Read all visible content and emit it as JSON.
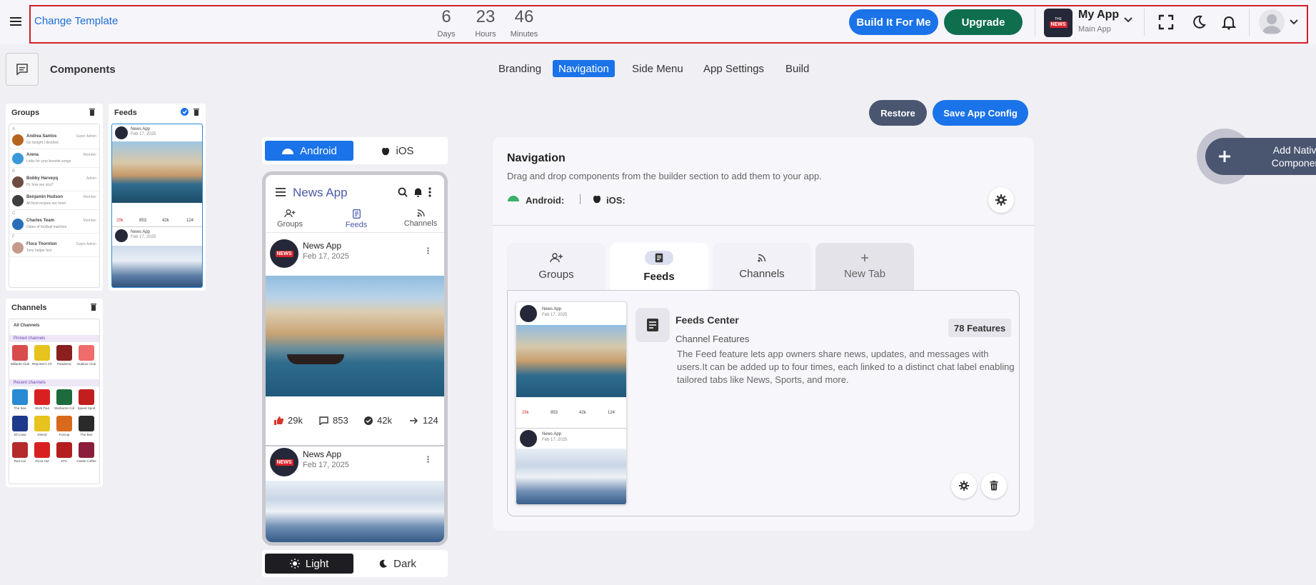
{
  "header": {
    "template_link": "Change Template",
    "countdown": [
      {
        "value": "6",
        "label": "Days"
      },
      {
        "value": "23",
        "label": "Hours"
      },
      {
        "value": "46",
        "label": "Minutes"
      }
    ],
    "build_btn": "Build It For Me",
    "upgrade_btn": "Upgrade",
    "app_name": "My App",
    "app_sub": "Main App",
    "logo_text_small": "THE",
    "logo_text": "NEWS"
  },
  "toolbar": {
    "components_title": "Components",
    "tabs": [
      "Branding",
      "Navigation",
      "Side Menu",
      "App Settings",
      "Build"
    ],
    "active_tab": "Navigation"
  },
  "left": {
    "groups_title": "Groups",
    "feeds_title": "Feeds",
    "channels_title": "Channels",
    "groups_list": [
      {
        "letter": "A",
        "name": "Andrea Santos",
        "msg": "Go tonight I decided",
        "role": "Super Admin",
        "color": "#b5651d"
      },
      {
        "letter": "",
        "name": "Arena",
        "msg": "Links for your favorite songs",
        "role": "Member",
        "color": "#3a9ad9"
      },
      {
        "letter": "B",
        "name": "Bobby Harveyq",
        "msg": "Hi, how are you?",
        "role": "Admin",
        "color": "#6d4c41"
      },
      {
        "letter": "",
        "name": "Benjamin Hudson",
        "msg": "All food recipes are here!",
        "role": "Member",
        "color": "#3e3e3e"
      },
      {
        "letter": "C",
        "name": "Charles Team",
        "msg": "Dates of football matches",
        "role": "Member",
        "color": "#2a6ebb"
      },
      {
        "letter": "F",
        "name": "Flora Thornton",
        "msg": "Tony helper text",
        "role": "Super Admin",
        "color": "#c49a8a"
      }
    ],
    "feeds_mini": {
      "name": "News App",
      "date": "Feb 17, 2025",
      "stats": [
        "29k",
        "853",
        "42k",
        "124"
      ]
    },
    "channels_header": "All Channels",
    "pinned_label": "Pinned channels",
    "recent_label": "Recent channels",
    "pinned": [
      {
        "name": "Billiards Club",
        "color": "#d94c4c"
      },
      {
        "name": "Reporter's Choice",
        "color": "#e8c21d"
      },
      {
        "name": "Pandemic",
        "color": "#8b1e1e"
      },
      {
        "name": "Outdoor Club",
        "color": "#f06b6b"
      }
    ],
    "recent": [
      {
        "name": "The Sea",
        "color": "#2a8ad4"
      },
      {
        "name": "Work Tour",
        "color": "#d92020"
      },
      {
        "name": "Starbucks Coffee",
        "color": "#1e6b3c"
      },
      {
        "name": "Speed Sport",
        "color": "#c21e1e"
      },
      {
        "name": "Ell Lowa",
        "color": "#1e3a8a"
      },
      {
        "name": "Dsend",
        "color": "#e8c21d"
      },
      {
        "name": "Foxcup",
        "color": "#d96a1d"
      },
      {
        "name": "The Bee",
        "color": "#2a2a2a"
      },
      {
        "name": "Red Car",
        "color": "#b52a2a"
      },
      {
        "name": "Pizza Hut",
        "color": "#d92020"
      },
      {
        "name": "KFC",
        "color": "#b51e1e"
      },
      {
        "name": "Castle Coffee",
        "color": "#8b1e3a"
      }
    ]
  },
  "phone": {
    "android_label": "Android",
    "ios_label": "iOS",
    "app_title": "News App",
    "nav": [
      "Groups",
      "Feeds",
      "Channels"
    ],
    "post1": {
      "name": "News App",
      "date": "Feb 17, 2025"
    },
    "post2": {
      "name": "News App",
      "date": "Feb 17, 2025"
    },
    "stats": [
      "29k",
      "853",
      "42k",
      "124"
    ],
    "light_label": "Light",
    "dark_label": "Dark"
  },
  "actions": {
    "restore": "Restore",
    "save": "Save App Config"
  },
  "navcard": {
    "title": "Navigation",
    "desc": "Drag and drop components from the builder section to add them to your app.",
    "android_label": "Android:",
    "ios_label": "iOS:",
    "tabs": [
      "Groups",
      "Feeds",
      "Channels",
      "New Tab"
    ],
    "feature_title": "Feeds Center",
    "feature_badge": "78 Features",
    "feature_sub": "Channel Features",
    "feature_desc": "The Feed feature lets app owners share news, updates, and messages with users.It can be added up to four times, each linked to a distinct chat label enabling tailored tabs like News, Sports, and more.",
    "preview": {
      "name": "News App",
      "date": "Feb 17, 2025",
      "stats": [
        "29k",
        "853",
        "42k",
        "124"
      ]
    }
  },
  "native": {
    "label_line1": "Add Native",
    "label_line2": "Component"
  },
  "colors": {
    "blue": "#1a73e8",
    "green": "#0e6e4e",
    "dark_btn": "#4a5670",
    "header_border": "#d0202a"
  }
}
